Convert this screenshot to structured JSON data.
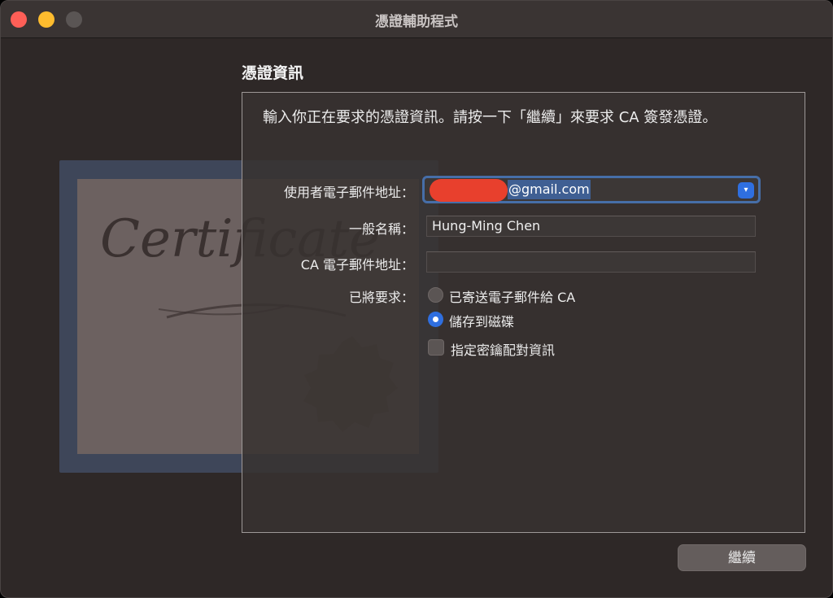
{
  "window": {
    "title": "憑證輔助程式"
  },
  "section": {
    "title": "憑證資訊",
    "instructions": "輸入你正在要求的憑證資訊。請按一下「繼續」來要求 CA 簽發憑證。"
  },
  "form": {
    "email_label": "使用者電子郵件地址：",
    "email_value": "@gmail.com",
    "common_name_label": "一般名稱：",
    "common_name_value": "Hung-Ming Chen",
    "ca_email_label": "CA 電子郵件地址：",
    "ca_email_value": "",
    "request_label": "已將要求：",
    "request_options": [
      {
        "label": "已寄送電子郵件給 CA",
        "selected": false
      },
      {
        "label": "儲存到磁碟",
        "selected": true
      }
    ],
    "key_pair_label": "指定密鑰配對資訊",
    "key_pair_checked": false
  },
  "buttons": {
    "continue": "繼續"
  },
  "background_art": {
    "certificate_word": "Certificate"
  },
  "colors": {
    "accent": "#2f6fe0",
    "close": "#fe5f57",
    "minimize": "#febc2e",
    "redaction": "#e8402d"
  }
}
